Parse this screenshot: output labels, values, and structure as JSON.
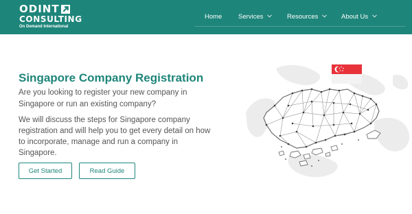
{
  "brand": {
    "name_top": "ODINT",
    "name_bottom": "CONSULTING",
    "tagline": "On Demand International",
    "logo_icon": "arrow-up-right-icon"
  },
  "nav": {
    "items": [
      {
        "label": "Home",
        "has_dropdown": false
      },
      {
        "label": "Services",
        "has_dropdown": true
      },
      {
        "label": "Resources",
        "has_dropdown": true
      },
      {
        "label": "About Us",
        "has_dropdown": true
      }
    ]
  },
  "hero": {
    "title": "Singapore Company Registration",
    "lead": "Are you looking to register your new company in Singapore or run an existing company?",
    "body": "We will discuss the steps for Singapore company registration and will help you to get every detail on how to incorporate, manage and run a company in Singapore.",
    "primary_button": "Get Started",
    "secondary_button": "Read Guide"
  },
  "illustration": {
    "name": "singapore-map-illustration",
    "flag_icon": "singapore-flag-icon"
  },
  "colors": {
    "brand": "#1e857a",
    "text": "#555555",
    "flag_red": "#e8333b"
  }
}
